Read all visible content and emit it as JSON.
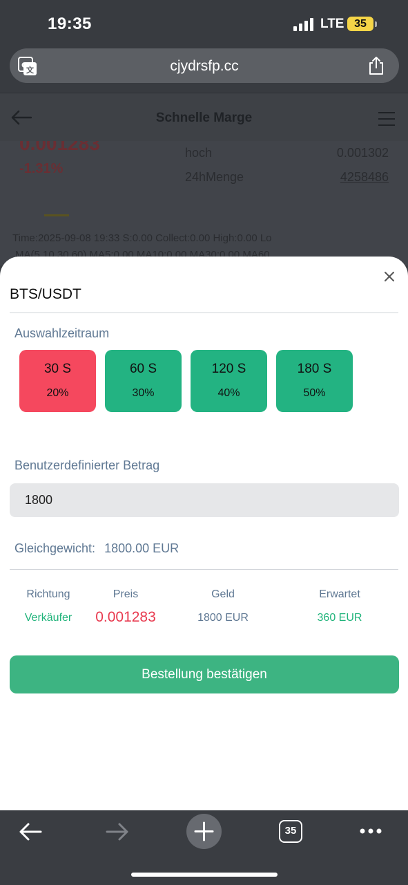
{
  "status_bar": {
    "time": "19:35",
    "network": "LTE",
    "battery": "35"
  },
  "browser": {
    "url": "cjydrsfp.cc",
    "tab_count": "35"
  },
  "background_page": {
    "title": "Schnelle Marge",
    "price": "0.001283",
    "change": "-1.31%",
    "high_label": "hoch",
    "high_value": "0.001302",
    "volume_label": "24hMenge",
    "volume_value": "4258486",
    "info_line": "Time:2025-09-08 19:33     S:0.00     Collect:0.00     High:0.00     Lo",
    "ma_line": "MA(5,10,30,60)     MA5:0.00     MA10:0.00     MA30:0.00     MA60"
  },
  "modal": {
    "pair": "BTS/USDT",
    "period_label": "Auswahlzeitraum",
    "periods": [
      {
        "time": "30 S",
        "rate": "20%",
        "selected": true
      },
      {
        "time": "60 S",
        "rate": "30%",
        "selected": false
      },
      {
        "time": "120 S",
        "rate": "40%",
        "selected": false
      },
      {
        "time": "180 S",
        "rate": "50%",
        "selected": false
      }
    ],
    "amount_label": "Benutzerdefinierter Betrag",
    "amount_value": "1800",
    "balance_label": "Gleichgewicht:",
    "balance_value": "1800.00 EUR",
    "headers": {
      "direction": "Richtung",
      "price": "Preis",
      "money": "Geld",
      "expected": "Erwartet"
    },
    "values": {
      "direction": "Verkäufer",
      "price": "0.001283",
      "money": "1800 EUR",
      "expected": "360 EUR"
    },
    "confirm_label": "Bestellung bestätigen"
  },
  "colors": {
    "selected": "#f5485e",
    "unselected": "#23b382",
    "green_text": "#1fb37a",
    "red_text": "#e83a4f",
    "label_text": "#5f7893"
  },
  "icons": [
    "translate-icon",
    "share-icon",
    "back-arrow-icon",
    "hamburger-menu-icon",
    "close-icon",
    "forward-arrow-icon",
    "plus-icon",
    "tabs-icon",
    "more-icon"
  ]
}
